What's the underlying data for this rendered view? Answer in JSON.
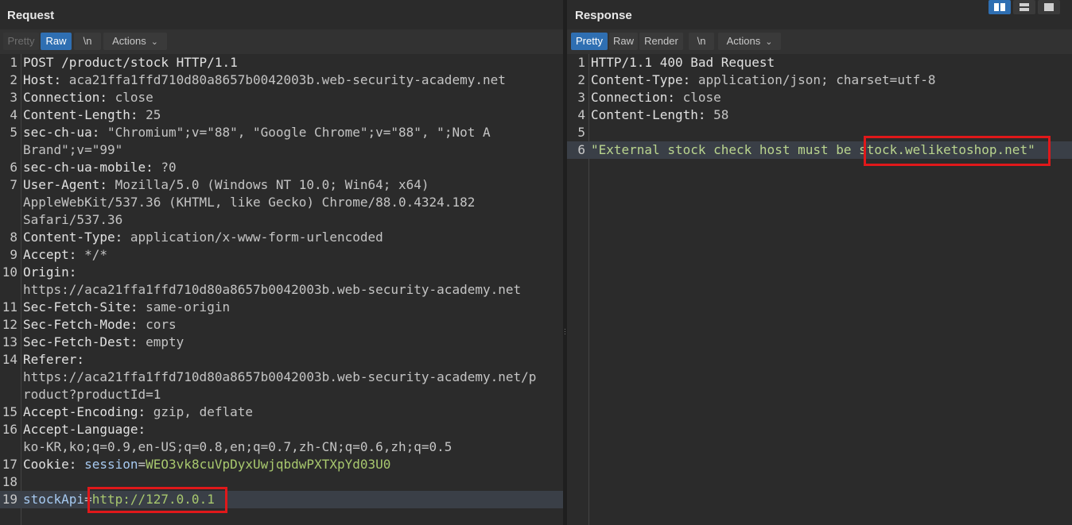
{
  "request": {
    "title": "Request",
    "buttons": [
      {
        "label": "Pretty",
        "state": "disabled"
      },
      {
        "label": "Raw",
        "state": "active"
      },
      {
        "label": "\\n",
        "state": "normal"
      },
      {
        "label": "Actions",
        "state": "normal"
      }
    ],
    "lines": [
      {
        "n": "1",
        "parts": [
          {
            "t": "POST /product/stock HTTP/1.1",
            "c": "k"
          }
        ]
      },
      {
        "n": "2",
        "parts": [
          {
            "t": "Host: ",
            "c": "k"
          },
          {
            "t": "aca21ffa1ffd710d80a8657b0042003b.web-security-academy.net",
            "c": "v"
          }
        ]
      },
      {
        "n": "3",
        "parts": [
          {
            "t": "Connection: ",
            "c": "k"
          },
          {
            "t": "close",
            "c": "v"
          }
        ]
      },
      {
        "n": "4",
        "parts": [
          {
            "t": "Content-Length: ",
            "c": "k"
          },
          {
            "t": "25",
            "c": "v"
          }
        ]
      },
      {
        "n": "5",
        "parts": [
          {
            "t": "sec-ch-ua: ",
            "c": "k"
          },
          {
            "t": "\"Chromium\";v=\"88\", \"Google Chrome\";v=\"88\", \";Not A",
            "c": "v"
          }
        ]
      },
      {
        "n": "",
        "parts": [
          {
            "t": "Brand\";v=\"99\"",
            "c": "v"
          }
        ]
      },
      {
        "n": "6",
        "parts": [
          {
            "t": "sec-ch-ua-mobile: ",
            "c": "k"
          },
          {
            "t": "?0",
            "c": "v"
          }
        ]
      },
      {
        "n": "7",
        "parts": [
          {
            "t": "User-Agent: ",
            "c": "k"
          },
          {
            "t": "Mozilla/5.0 (Windows NT 10.0; Win64; x64)",
            "c": "v"
          }
        ]
      },
      {
        "n": "",
        "parts": [
          {
            "t": "AppleWebKit/537.36 (KHTML, like Gecko) Chrome/88.0.4324.182",
            "c": "v"
          }
        ]
      },
      {
        "n": "",
        "parts": [
          {
            "t": "Safari/537.36",
            "c": "v"
          }
        ]
      },
      {
        "n": "8",
        "parts": [
          {
            "t": "Content-Type: ",
            "c": "k"
          },
          {
            "t": "application/x-www-form-urlencoded",
            "c": "v"
          }
        ]
      },
      {
        "n": "9",
        "parts": [
          {
            "t": "Accept: ",
            "c": "k"
          },
          {
            "t": "*/*",
            "c": "v"
          }
        ]
      },
      {
        "n": "10",
        "parts": [
          {
            "t": "Origin: ",
            "c": "k"
          }
        ]
      },
      {
        "n": "",
        "parts": [
          {
            "t": "https://aca21ffa1ffd710d80a8657b0042003b.web-security-academy.net",
            "c": "v"
          }
        ]
      },
      {
        "n": "11",
        "parts": [
          {
            "t": "Sec-Fetch-Site: ",
            "c": "k"
          },
          {
            "t": "same-origin",
            "c": "v"
          }
        ]
      },
      {
        "n": "12",
        "parts": [
          {
            "t": "Sec-Fetch-Mode: ",
            "c": "k"
          },
          {
            "t": "cors",
            "c": "v"
          }
        ]
      },
      {
        "n": "13",
        "parts": [
          {
            "t": "Sec-Fetch-Dest: ",
            "c": "k"
          },
          {
            "t": "empty",
            "c": "v"
          }
        ]
      },
      {
        "n": "14",
        "parts": [
          {
            "t": "Referer: ",
            "c": "k"
          }
        ]
      },
      {
        "n": "",
        "parts": [
          {
            "t": "https://aca21ffa1ffd710d80a8657b0042003b.web-security-academy.net/p",
            "c": "v"
          }
        ]
      },
      {
        "n": "",
        "parts": [
          {
            "t": "roduct?productId=1",
            "c": "v"
          }
        ]
      },
      {
        "n": "15",
        "parts": [
          {
            "t": "Accept-Encoding: ",
            "c": "k"
          },
          {
            "t": "gzip, deflate",
            "c": "v"
          }
        ]
      },
      {
        "n": "16",
        "parts": [
          {
            "t": "Accept-Language: ",
            "c": "k"
          }
        ]
      },
      {
        "n": "",
        "parts": [
          {
            "t": "ko-KR,ko;q=0.9,en-US;q=0.8,en;q=0.7,zh-CN;q=0.6,zh;q=0.5",
            "c": "v"
          }
        ]
      },
      {
        "n": "17",
        "parts": [
          {
            "t": "Cookie: ",
            "c": "k"
          },
          {
            "t": "session",
            "c": "c"
          },
          {
            "t": "=",
            "c": "v"
          },
          {
            "t": "WEO3vk8cuVpDyxUwjqbdwPXTXpYd03U0",
            "c": "g"
          }
        ]
      },
      {
        "n": "18",
        "parts": []
      },
      {
        "n": "19",
        "parts": [
          {
            "t": "stockApi",
            "c": "c"
          },
          {
            "t": "=",
            "c": "v"
          },
          {
            "t": "http://127.0.0.1",
            "c": "g"
          }
        ],
        "highlight": true
      }
    ]
  },
  "response": {
    "title": "Response",
    "buttons": [
      {
        "label": "Pretty",
        "state": "active"
      },
      {
        "label": "Raw",
        "state": "normal"
      },
      {
        "label": "Render",
        "state": "normal"
      },
      {
        "label": "\\n",
        "state": "normal"
      },
      {
        "label": "Actions",
        "state": "normal"
      }
    ],
    "lines": [
      {
        "n": "1",
        "parts": [
          {
            "t": "HTTP/1.1 400 Bad Request",
            "c": "k"
          }
        ]
      },
      {
        "n": "2",
        "parts": [
          {
            "t": "Content-Type: ",
            "c": "k"
          },
          {
            "t": "application/json; charset=utf-8",
            "c": "v"
          }
        ]
      },
      {
        "n": "3",
        "parts": [
          {
            "t": "Connection: ",
            "c": "k"
          },
          {
            "t": "close",
            "c": "v"
          }
        ]
      },
      {
        "n": "4",
        "parts": [
          {
            "t": "Content-Length: ",
            "c": "k"
          },
          {
            "t": "58",
            "c": "v"
          }
        ]
      },
      {
        "n": "5",
        "parts": []
      },
      {
        "n": "6",
        "parts": [
          {
            "t": "\"External stock check host must be stock.weliketoshop.net\"",
            "c": "s"
          }
        ],
        "highlight": true
      }
    ]
  },
  "layout_toggle": {
    "options": [
      "split-horizontal",
      "split-vertical",
      "tabs"
    ],
    "selected": "split-horizontal"
  },
  "colors": {
    "accent": "#2f6fb2",
    "annotation": "#e0181a",
    "background": "#2b2b2b"
  }
}
